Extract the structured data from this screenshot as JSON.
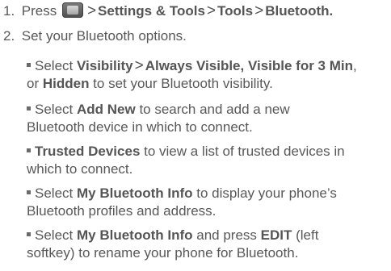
{
  "steps": [
    {
      "number": "1.",
      "prefix": "Press",
      "path": [
        "Settings & Tools",
        "Tools",
        "Bluetooth."
      ],
      "separator": ">"
    },
    {
      "number": "2.",
      "text": "Set your Bluetooth options."
    }
  ],
  "bullets": [
    {
      "lead": "Select ",
      "b1": "Visibility",
      "sep": ">",
      "b2": "Always Visible, Visible for 3 Min",
      "mid": ",",
      "line2a": "or ",
      "b3": "Hidden",
      "tail": " to set your Bluetooth visibility."
    },
    {
      "lead": "Select ",
      "b1": "Add New",
      "tail": " to search and add a new",
      "line2": "Bluetooth device in which to connect."
    },
    {
      "b1": "Trusted Devices",
      "tail": " to view a list of trusted devices in",
      "line2": "which to connect."
    },
    {
      "lead": "Select ",
      "b1": "My Bluetooth Info",
      "tail": " to display your phone’s",
      "line2": "Bluetooth profiles and address."
    },
    {
      "lead": "Select ",
      "b1": "My Bluetooth Info",
      "mid": " and press ",
      "b2": "EDIT",
      "tail": " (left",
      "line2": "softkey) to rename your phone for Bluetooth."
    }
  ],
  "icons": {
    "menu_key": "menu-key-icon",
    "bullet": "square-bullet-icon"
  },
  "colors": {
    "text": "#585858",
    "bold_text": "#555555",
    "key_dark": "#4e4e4e",
    "key_face": "#d8d8d8"
  }
}
